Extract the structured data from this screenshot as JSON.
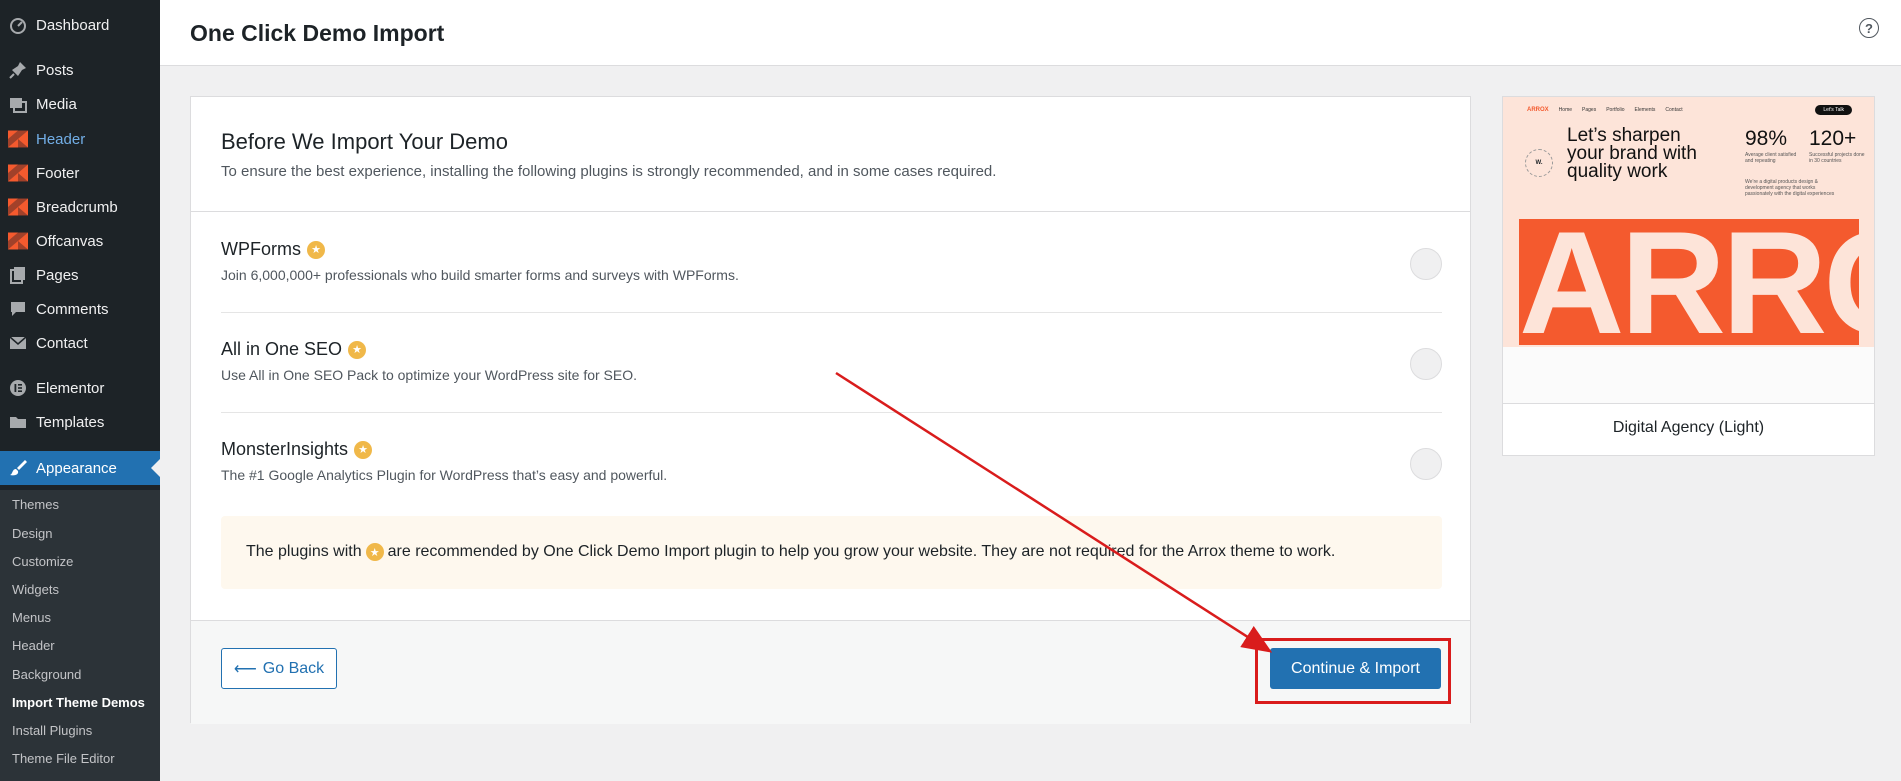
{
  "sidebar": {
    "items": [
      {
        "label": "Dashboard",
        "icon": "dashboard-icon"
      },
      {
        "label": "Posts",
        "icon": "pin-icon"
      },
      {
        "label": "Media",
        "icon": "media-icon"
      },
      {
        "label": "Header",
        "icon": "brand-icon"
      },
      {
        "label": "Footer",
        "icon": "brand-icon"
      },
      {
        "label": "Breadcrumb",
        "icon": "brand-icon"
      },
      {
        "label": "Offcanvas",
        "icon": "brand-icon"
      },
      {
        "label": "Pages",
        "icon": "pages-icon"
      },
      {
        "label": "Comments",
        "icon": "comments-icon"
      },
      {
        "label": "Contact",
        "icon": "mail-icon"
      },
      {
        "label": "Elementor",
        "icon": "elementor-icon"
      },
      {
        "label": "Templates",
        "icon": "folder-icon"
      },
      {
        "label": "Appearance",
        "icon": "brush-icon"
      }
    ],
    "submenu": [
      "Themes",
      "Design",
      "Customize",
      "Widgets",
      "Menus",
      "Header",
      "Background",
      "Import Theme Demos",
      "Install Plugins",
      "Theme File Editor"
    ]
  },
  "header": {
    "title": "One Click Demo Import",
    "help_glyph": "?"
  },
  "card": {
    "title": "Before We Import Your Demo",
    "description": "To ensure the best experience, installing the following plugins is strongly recommended, and in some cases required.",
    "plugins": [
      {
        "name": "WPForms",
        "description": "Join 6,000,000+ professionals who build smarter forms and surveys with WPForms."
      },
      {
        "name": "All in One SEO",
        "description": "Use All in One SEO Pack to optimize your WordPress site for SEO."
      },
      {
        "name": "MonsterInsights",
        "description": "The #1 Google Analytics Plugin for WordPress that’s easy and powerful."
      }
    ],
    "notice_before": "The plugins with",
    "notice_after": "are recommended by One Click Demo Import plugin to help you grow your website. They are not required for the Arrox theme to work.",
    "back_label": "Go Back",
    "back_arrow": "⟵",
    "continue_label": "Continue & Import",
    "star_glyph": "★"
  },
  "preview": {
    "title": "Digital Agency (Light)",
    "logo": "ARROX",
    "nav": [
      "Home",
      "Pages",
      "Portfolio",
      "Elements",
      "Contact"
    ],
    "cta": "Let's Talk",
    "headline": "Let’s sharpen your brand with quality work",
    "stat1": "98%",
    "stat1_sub": "Average client satisfied and repeating",
    "stat2": "120+",
    "stat2_sub": "Successful projects done in 30 countries",
    "para": "We’re a digital products design & development agency that works passionately with the digital experiences",
    "seal": "W.",
    "big_text": "ARROX"
  },
  "colors": {
    "accent": "#2271b1",
    "annotation_red": "#d91c1c",
    "brand_orange": "#f45a2e"
  }
}
